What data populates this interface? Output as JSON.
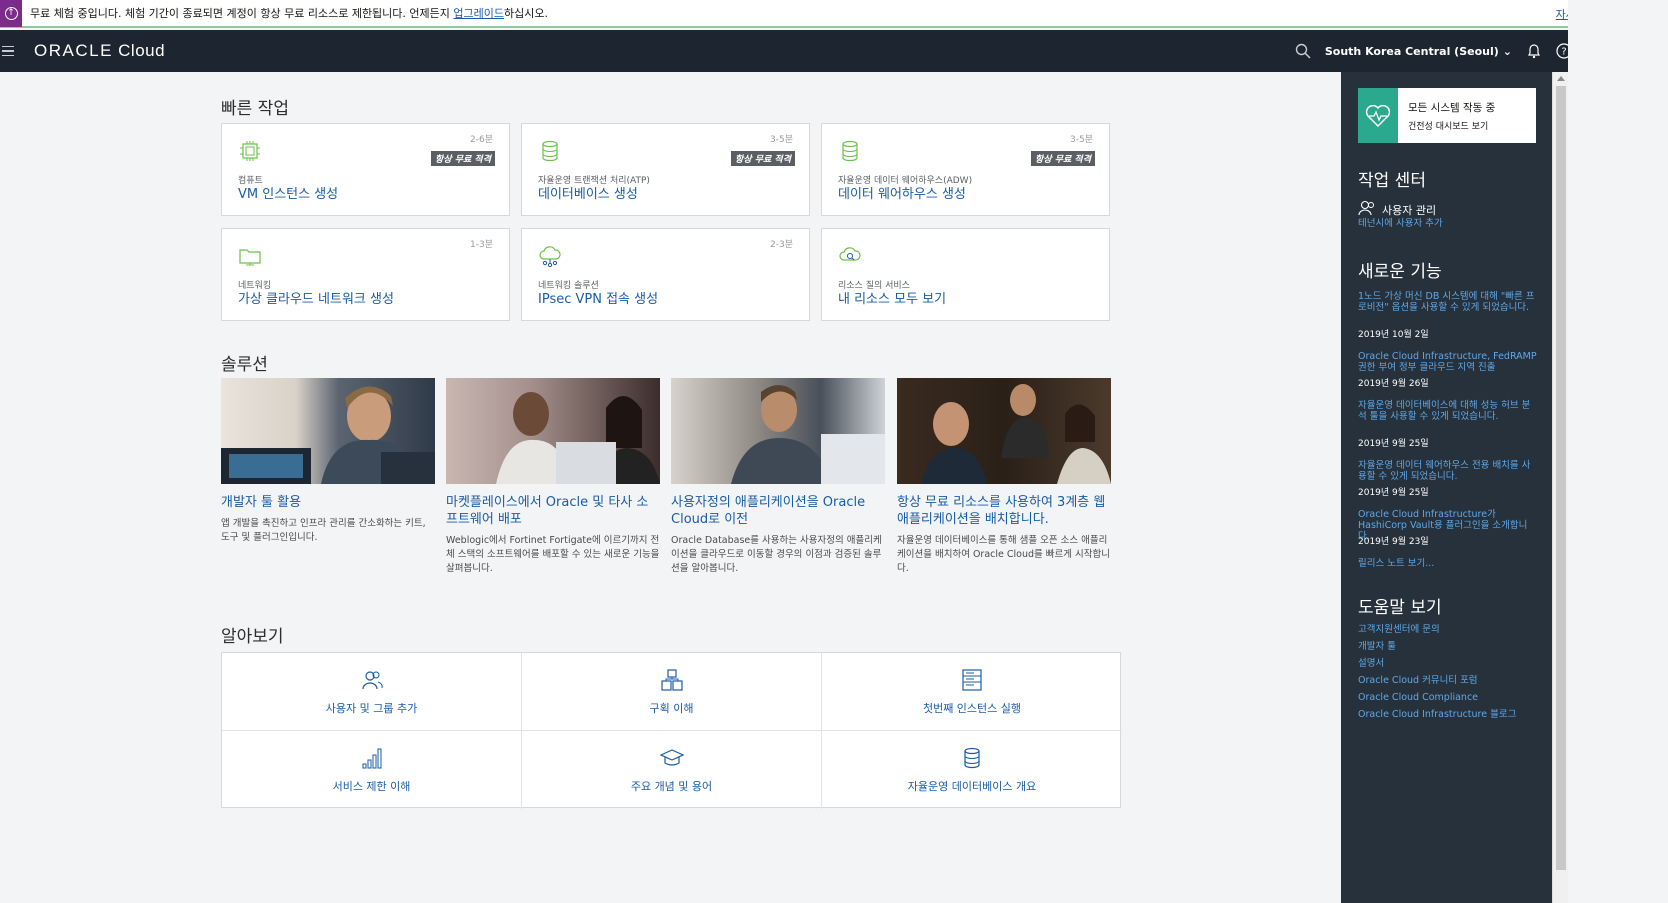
{
  "banner": {
    "text_before": "무료 체험 중입니다. 체험 기간이 종료되면 계정이 항상 무료 리소스로 제한됩니다. 언제든지 ",
    "upgrade_link": "업그레이드",
    "text_after": "하십시오.",
    "more_link": "자세히 알아보기",
    "close": "✕"
  },
  "topnav": {
    "logo_brand": "ORACLE",
    "logo_product": " Cloud",
    "region": "South Korea Central (Seoul)"
  },
  "quick": {
    "title": "빠른 작업",
    "cards": [
      {
        "time": "2-6분",
        "badge": "항상 무료 적격",
        "sub": "컴퓨트",
        "label": "VM 인스턴스 생성"
      },
      {
        "time": "3-5분",
        "badge": "항상 무료 적격",
        "sub": "자율운영 트랜잭션 처리(ATP)",
        "label": "데이터베이스 생성"
      },
      {
        "time": "3-5분",
        "badge": "항상 무료 적격",
        "sub": "자율운영 데이터 웨어하우스(ADW)",
        "label": "데이터 웨어하우스 생성"
      },
      {
        "time": "1-3분",
        "sub": "네트워킹",
        "label": "가상 클라우드 네트워크 생성"
      },
      {
        "time": "2-3분",
        "sub": "네트워킹 솔루션",
        "label": "IPsec VPN 접속 생성"
      },
      {
        "sub": "리소스 질의 서비스",
        "label": "내 리소스 모두 보기"
      }
    ]
  },
  "solutions": {
    "title": "솔루션",
    "items": [
      {
        "title": "개발자 툴 활용",
        "desc": "앱 개발을 촉진하고 인프라 관리를 간소화하는 키트, 도구 및 플러그인입니다."
      },
      {
        "title": "마켓플레이스에서 Oracle 및 타사 소프트웨어 배포",
        "desc": "Weblogic에서 Fortinet Fortigate에 이르기까지 전체 스택의 소프트웨어를 배포할 수 있는 새로운 기능을 살펴봅니다."
      },
      {
        "title": "사용자정의 애플리케이션을 Oracle Cloud로 이전",
        "desc": "Oracle Database를 사용하는 사용자정의 애플리케이션을 클라우드로 이동할 경우의 이점과 검증된 솔루션을 알아봅니다."
      },
      {
        "title": "항상 무료 리소스를 사용하여 3계층 웹 애플리케이션을 배치합니다.",
        "desc": "자율운영 데이터베이스를 통해 샘플 오픈 소스 애플리케이션을 배치하여 Oracle Cloud를 빠르게 시작합니다."
      }
    ]
  },
  "learn": {
    "title": "알아보기",
    "items": [
      {
        "label": "사용자 및 그룹 추가"
      },
      {
        "label": "구획 이해"
      },
      {
        "label": "첫번째 인스턴스 실행"
      },
      {
        "label": "서비스 제한 이해"
      },
      {
        "label": "주요 개념 및 용어"
      },
      {
        "label": "자율운영 데이터베이스 개요"
      }
    ]
  },
  "sidebar": {
    "status_title": "모든 시스템 작동 중",
    "status_link": "건전성 대시보드 보기",
    "work_center": "작업 센터",
    "user_mgmt": "사용자 관리",
    "add_user": "테넌시에 사용자 추가",
    "whats_new": "새로운 기능",
    "news": [
      {
        "text": "1노드 가상 머신 DB 시스템에 대해 \"빠른 프로비전\" 옵션을 사용할 수 있게 되었습니다.",
        "date": "2019년 10월 2일"
      },
      {
        "text": "Oracle Cloud Infrastructure, FedRAMP 권한 부여 정부 클라우드 지역 진출",
        "date": "2019년 9월 26일"
      },
      {
        "text": "자율운영 데이터베이스에 대해 성능 허브 분석 툴을 사용할 수 있게 되었습니다.",
        "date": "2019년 9월 25일"
      },
      {
        "text": "자율운영 데이터 웨어하우스 전용 배치를 사용할 수 있게 되었습니다.",
        "date": "2019년 9월 25일"
      },
      {
        "text": "Oracle Cloud Infrastructure가 HashiCorp Vault용 플러그인을 소개합니다.",
        "date": "2019년 9월 23일"
      }
    ],
    "release_notes": "릴리스 노트 보기...",
    "help_title": "도움말 보기",
    "help_links": [
      "고객지원센터에 문의",
      "개발자 툴",
      "설명서",
      "Oracle Cloud 커뮤니티 포럼",
      "Oracle Cloud Compliance",
      "Oracle Cloud Infrastructure 블로그"
    ]
  },
  "colors": {
    "nav_bg": "#1c2530",
    "sidebar_bg": "#26313c",
    "link": "#1a5ca8",
    "status_green": "#2aa98e",
    "icon_green": "#6cc04a"
  }
}
